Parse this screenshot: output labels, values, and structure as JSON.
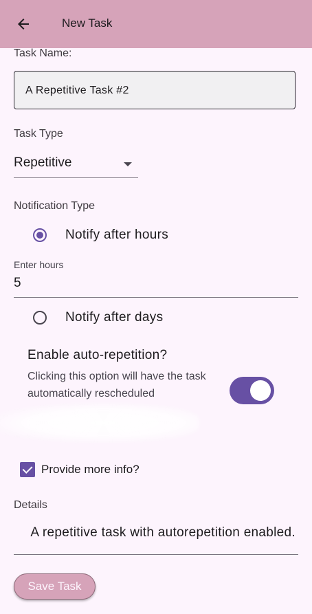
{
  "app_bar": {
    "title": "New Task",
    "back_icon": "arrow-left-icon",
    "background": "#d6a3b9"
  },
  "form": {
    "task_name_label": "Task Name:",
    "task_name_value": "A Repetitive Task #2",
    "task_type_label": "Task Type",
    "task_type_value": "Repetitive",
    "notification_type_label": "Notification Type",
    "notification_options": [
      {
        "label": "Notify after hours",
        "selected": true
      },
      {
        "label": "Notify after days",
        "selected": false
      }
    ],
    "hours_label": "Enter hours",
    "hours_value": "5",
    "auto_repetition_title": "Enable auto-repetition?",
    "auto_repetition_subtitle": "Clicking this option will have the task automatically rescheduled",
    "auto_repetition_enabled": true,
    "more_info_label": "Provide more info?",
    "more_info_checked": true,
    "details_label": "Details",
    "details_value": "A repetitive task with autorepetition enabled.",
    "save_button_label": "Save Task"
  },
  "colors": {
    "accent": "#6750a4",
    "background": "#fdf4fd",
    "primary_pink": "#d6a3b9"
  }
}
